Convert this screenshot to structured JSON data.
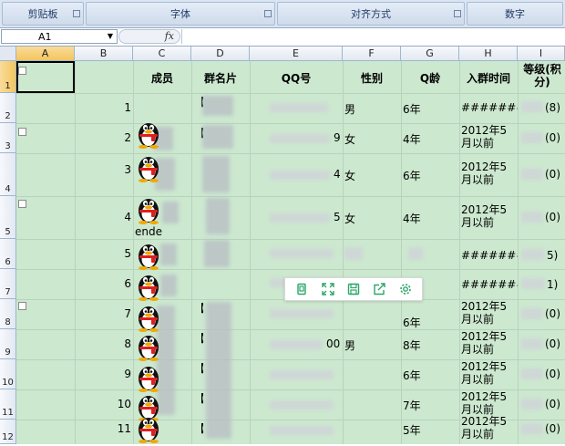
{
  "ribbon": {
    "groups": [
      "剪贴板",
      "字体",
      "对齐方式",
      "数字"
    ]
  },
  "formula_bar": {
    "cell_ref": "A1",
    "fx_label": "fx"
  },
  "columns": [
    "A",
    "B",
    "C",
    "D",
    "E",
    "F",
    "G",
    "H",
    "I"
  ],
  "rows": [
    "1",
    "2",
    "3",
    "4",
    "5",
    "6",
    "7",
    "8",
    "9",
    "10",
    "11",
    "12"
  ],
  "headers": {
    "member": "成员",
    "group_card": "群名片",
    "qq": "QQ号",
    "gender": "性别",
    "q_age": "Q龄",
    "join_time": "入群时间",
    "level": "等级(积分)"
  },
  "data_rows": [
    {
      "num": "1",
      "name_frag": "",
      "card_frag": "【",
      "qq_tail": "",
      "gender": "男",
      "q_age": "6年",
      "join": "########",
      "level": "(8)"
    },
    {
      "num": "2",
      "name_frag": "",
      "card_frag": "【",
      "qq_tail": "9",
      "gender": "女",
      "q_age": "4年",
      "join": "2012年5月以前",
      "level": "(0)"
    },
    {
      "num": "3",
      "name_frag": "",
      "card_frag": "",
      "qq_tail": "4",
      "gender": "女",
      "q_age": "6年",
      "join": "2012年5月以前",
      "level": "(0)"
    },
    {
      "num": "4",
      "name_frag": "ende",
      "card_frag": "",
      "qq_tail": "5",
      "gender": "女",
      "q_age": "4年",
      "join": "2012年5月以前",
      "level": "(0)"
    },
    {
      "num": "5",
      "name_frag": "",
      "card_frag": "",
      "qq_tail": "",
      "gender": "",
      "q_age": "",
      "join": "########",
      "level": "5)"
    },
    {
      "num": "6",
      "name_frag": "",
      "card_frag": "",
      "qq_tail": "",
      "gender": "",
      "q_age": "",
      "join": "########",
      "level": "1)"
    },
    {
      "num": "7",
      "name_frag": "",
      "card_frag": "【",
      "qq_tail": "",
      "gender": "",
      "q_age": "6年",
      "join": "2012年5月以前",
      "level": "(0)"
    },
    {
      "num": "8",
      "name_frag": "",
      "card_frag": "【",
      "qq_tail": "00",
      "gender": "男",
      "q_age": "8年",
      "join": "2012年5月以前",
      "level": "(0)"
    },
    {
      "num": "9",
      "name_frag": "",
      "card_frag": "【",
      "qq_tail": "",
      "gender": "",
      "q_age": "6年",
      "join": "2012年5月以前",
      "level": "(0)"
    },
    {
      "num": "10",
      "name_frag": "",
      "card_frag": "【",
      "qq_tail": "",
      "gender": "",
      "q_age": "7年",
      "join": "2012年5月以前",
      "level": "(0)"
    },
    {
      "num": "11",
      "name_frag": "",
      "card_frag": "【",
      "qq_tail": "",
      "gender": "",
      "q_age": "5年",
      "join": "2012年5月以前",
      "level": "(0)"
    }
  ],
  "float_toolbar": {
    "icons": [
      "copy-icon",
      "expand-icon",
      "save-icon",
      "share-icon",
      "settings-icon"
    ]
  },
  "colors": {
    "grid_bg": "#cce8cf",
    "header_bg": "#e2e8f1",
    "selected_header": "#f3c55d",
    "toolbar_icon": "#2ca66a"
  }
}
